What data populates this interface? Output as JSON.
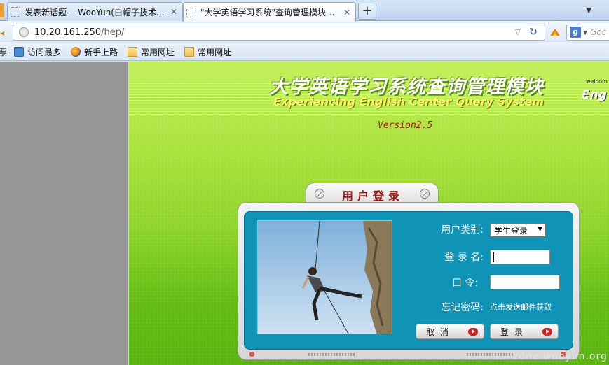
{
  "browser": {
    "tabs": [
      {
        "title": "发表新话题 -- WooYun(白帽子技术...",
        "active": false
      },
      {
        "title": "\"大学英语学习系统\"查询管理模块--...",
        "active": true
      }
    ],
    "new_tab_label": "+",
    "url_host": "10.20.161.250",
    "url_path": "/hep/",
    "search_placeholder": "Goc",
    "search_engine_letter": "g"
  },
  "bookmarks": {
    "back_stub": "票",
    "items": [
      {
        "label": "访问最多",
        "icon": "most-visited-icon"
      },
      {
        "label": "新手上路",
        "icon": "firefox-icon"
      },
      {
        "label": "常用网址",
        "icon": "folder-icon"
      },
      {
        "label": "常用网址",
        "icon": "folder-icon"
      }
    ]
  },
  "page": {
    "title_cn": "大学英语学习系统查询管理模块",
    "title_en": "Experiencing English Center Query System",
    "welcome": "welcom",
    "eng_stub": "Eng",
    "version": "Version2.5",
    "login_header": "用户登录",
    "form": {
      "user_type_label": "用户类别:",
      "user_type_value": "学生登录",
      "login_name_label": "登  录  名:",
      "login_name_value": "",
      "password_label": "口        令:",
      "password_value": "",
      "forgot_label": "忘记密码:",
      "forgot_hint": "点击发送邮件获取",
      "cancel_label": "取消",
      "login_label": "登录"
    }
  },
  "watermark": "zone.wooyun.org",
  "colors": {
    "panel_blue": "#0f94b7",
    "page_green": "#8ed42a",
    "version_red": "#b01818"
  }
}
